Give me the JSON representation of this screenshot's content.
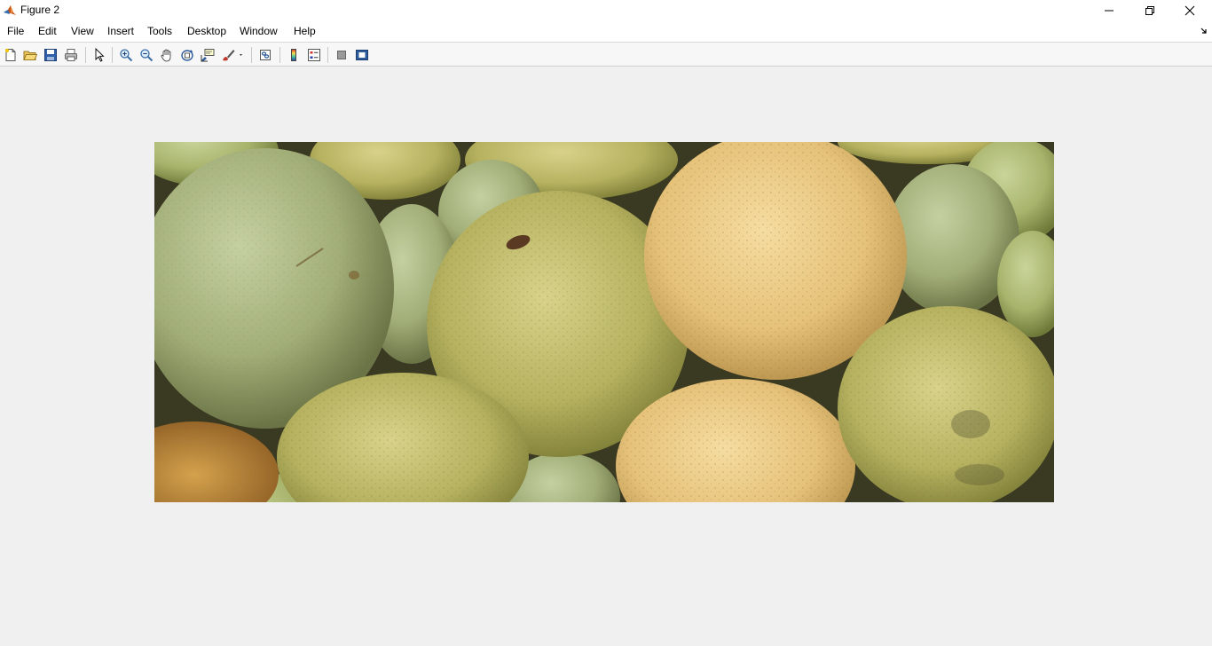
{
  "window": {
    "title": "Figure 2",
    "icon": "matlab-logo-icon",
    "controls": [
      "minimize-icon",
      "restore-icon",
      "close-icon"
    ]
  },
  "menubar": {
    "items": [
      "File",
      "Edit",
      "View",
      "Insert",
      "Tools",
      "Desktop",
      "Window",
      "Help"
    ],
    "overflow_icon": "dock-arrow-icon"
  },
  "toolbar": {
    "buttons": [
      "new-figure-icon",
      "open-file-icon",
      "save-figure-icon",
      "print-figure-icon",
      "edit-plot-icon",
      "zoom-in-icon",
      "zoom-out-icon",
      "pan-icon",
      "rotate-3d-icon",
      "data-cursor-icon",
      "brush-icon",
      "link-plot-icon",
      "insert-colorbar-icon",
      "insert-legend-icon",
      "hide-plot-tools-icon",
      "show-plot-tools-icon"
    ]
  },
  "figure": {
    "image": "photo of green-yellow round fruits (guavas / asian pears) tightly packed",
    "background": "#f0f0f0"
  }
}
